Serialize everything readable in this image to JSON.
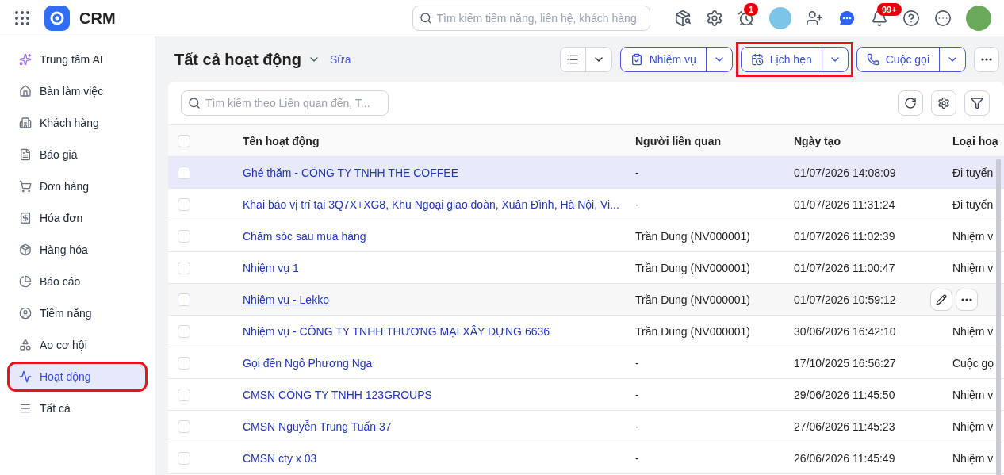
{
  "app": {
    "name": "CRM"
  },
  "top_search": {
    "placeholder": "Tìm kiếm tiềm năng, liên hệ, khách hàng"
  },
  "timer_badge": "1",
  "notification_badge": "99+",
  "sidebar": {
    "items": [
      {
        "label": "Trung tâm AI",
        "selected": false,
        "highlighted": false
      },
      {
        "label": "Bàn làm việc",
        "selected": false,
        "highlighted": false
      },
      {
        "label": "Khách hàng",
        "selected": false,
        "highlighted": false
      },
      {
        "label": "Báo giá",
        "selected": false,
        "highlighted": false
      },
      {
        "label": "Đơn hàng",
        "selected": false,
        "highlighted": false
      },
      {
        "label": "Hóa đơn",
        "selected": false,
        "highlighted": false
      },
      {
        "label": "Hàng hóa",
        "selected": false,
        "highlighted": false
      },
      {
        "label": "Báo cáo",
        "selected": false,
        "highlighted": false
      },
      {
        "label": "Tiềm năng",
        "selected": false,
        "highlighted": false
      },
      {
        "label": "Ao cơ hội",
        "selected": false,
        "highlighted": false
      },
      {
        "label": "Hoạt động",
        "selected": true,
        "highlighted": true
      },
      {
        "label": "Tất cả",
        "selected": false,
        "highlighted": false
      }
    ]
  },
  "page": {
    "title": "Tất cả hoạt động",
    "edit_link": "Sửa",
    "actions": [
      {
        "label": "Nhiệm vụ",
        "highlighted": false
      },
      {
        "label": "Lịch hẹn",
        "highlighted": true
      },
      {
        "label": "Cuộc gọi",
        "highlighted": false
      }
    ]
  },
  "table": {
    "search": {
      "placeholder": "Tìm kiếm theo Liên quan đến, T..."
    },
    "select_all": {
      "checked": false
    },
    "columns": [
      "Tên hoạt động",
      "Người liên quan",
      "Ngày tạo",
      "Loại hoạ"
    ],
    "rows": [
      {
        "name": "Ghé thăm - CÔNG TY TNHH THE COFFEE",
        "person": "-",
        "created": "01/07/2026 14:08:09",
        "type": "Đi tuyến",
        "selected": true,
        "hovered": false
      },
      {
        "name": "Khai báo vị trí tại 3Q7X+XG8, Khu Ngoại giao đoàn, Xuân Đình, Hà Nội, Vi...",
        "person": "-",
        "created": "01/07/2026 11:31:24",
        "type": "Đi tuyến",
        "selected": false,
        "hovered": false
      },
      {
        "name": "Chăm sóc sau mua hàng",
        "person": "Trần Dung (NV000001)",
        "created": "01/07/2026 11:02:39",
        "type": "Nhiệm v",
        "selected": false,
        "hovered": false
      },
      {
        "name": "Nhiệm vụ 1",
        "person": "Trần Dung (NV000001)",
        "created": "01/07/2026 11:00:47",
        "type": "Nhiệm v",
        "selected": false,
        "hovered": false
      },
      {
        "name": "Nhiệm vụ - Lekko",
        "person": "Trần Dung (NV000001)",
        "created": "01/07/2026 10:59:12",
        "selected": false,
        "hovered": true
      },
      {
        "name": "Nhiệm vụ - CÔNG TY TNHH THƯƠNG MẠI XÂY DỰNG 6636",
        "person": "Trần Dung (NV000001)",
        "created": "30/06/2026 16:42:10",
        "type": "Nhiệm v",
        "selected": false,
        "hovered": false
      },
      {
        "name": "Gọi đến Ngô Phương Nga",
        "person": "-",
        "created": "17/10/2025 16:56:27",
        "type": "Cuộc gọ",
        "selected": false,
        "hovered": false
      },
      {
        "name": "CMSN CÔNG TY TNHH 123GROUPS",
        "person": "-",
        "created": "29/06/2026 11:45:50",
        "type": "Nhiệm v",
        "selected": false,
        "hovered": false
      },
      {
        "name": "CMSN Nguyễn Trung Tuấn 37",
        "person": "-",
        "created": "27/06/2026 11:45:23",
        "type": "Nhiệm v",
        "selected": false,
        "hovered": false
      },
      {
        "name": "CMSN cty x 03",
        "person": "-",
        "created": "26/06/2026 11:45:49",
        "type": "Nhiệm v",
        "selected": false,
        "hovered": false
      }
    ]
  }
}
